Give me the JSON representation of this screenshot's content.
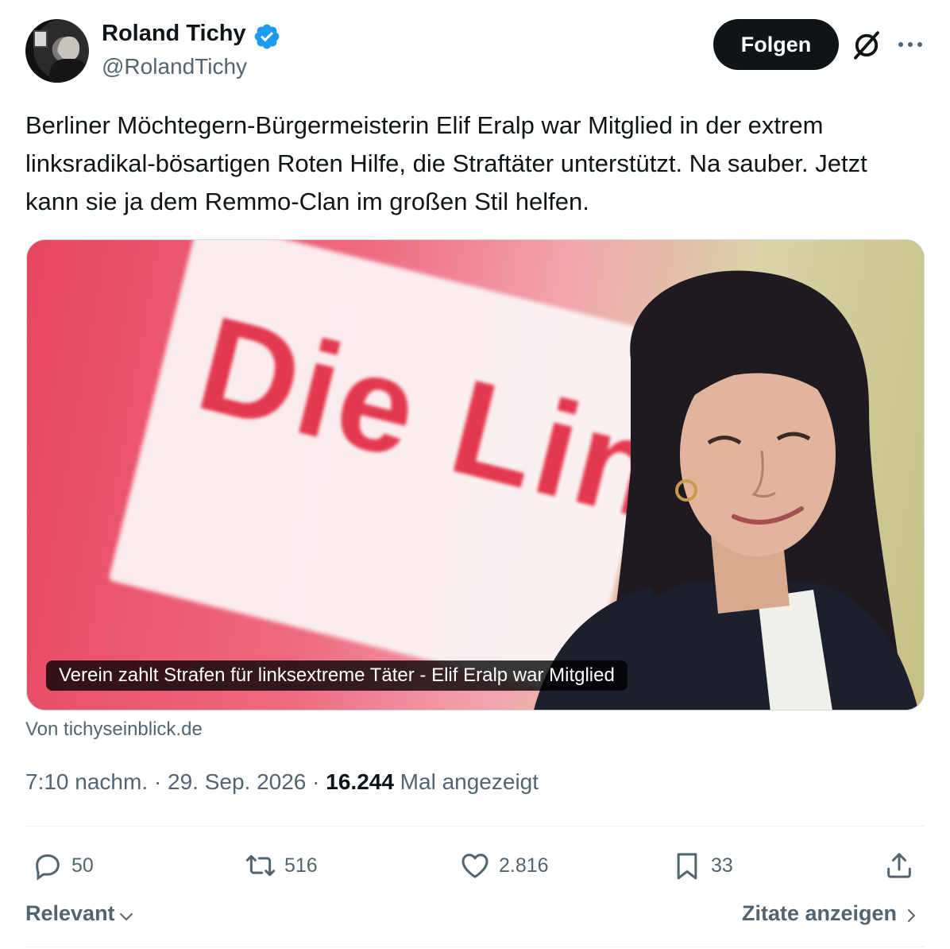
{
  "author": {
    "name": "Roland Tichy",
    "handle": "@RolandTichy",
    "verified_color": "#1d9bf0"
  },
  "header": {
    "follow_label": "Folgen"
  },
  "tweet": {
    "text": "Berliner Möchtegern-Bürgermeisterin Elif Eralp war Mitglied in der extrem linksradikal-bösartigen Roten Hilfe, die Straftäter unterstützt. Na sauber. Jetzt kann sie ja dem Remmo-Clan im großen Stil helfen."
  },
  "media": {
    "sign_text": "Die Linke",
    "caption": "Verein zahlt Strafen für linksextreme Täter - Elif Eralp war Mitglied"
  },
  "source": "Von tichyseinblick.de",
  "meta": {
    "time": "7:10 nachm.",
    "sep1": " · ",
    "date": "29. Sep. 2026",
    "sep2": " · ",
    "views": "16.244",
    "views_label": " Mal angezeigt"
  },
  "actions": {
    "replies": "50",
    "reposts": "516",
    "likes": "2.816",
    "bookmarks": "33"
  },
  "footer": {
    "sort_label": "Relevant",
    "quotes_label": "Zitate anzeigen"
  },
  "icons": {
    "verified": "verified-badge-icon",
    "grok": "grok-icon",
    "more": "more-icon",
    "reply": "reply-icon",
    "repost": "repost-icon",
    "like": "like-icon",
    "bookmark": "bookmark-icon",
    "share": "share-icon"
  }
}
